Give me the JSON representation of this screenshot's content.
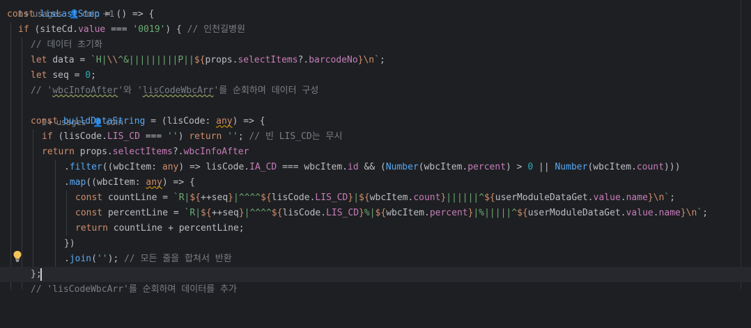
{
  "hints": {
    "top_usages": "1+ usages",
    "top_author": "coin +1",
    "build_usages": "1+ usages",
    "build_author": "coin"
  },
  "code": {
    "l1": {
      "a": "const ",
      "b": "lisLastStep",
      "c": " = () => {"
    },
    "l2": {
      "a": "if",
      "b": " (siteCd.",
      "c": "value",
      "d": " === ",
      "e": "'0019'",
      "f": ") { ",
      "g": "// 인천길병원"
    },
    "l3": {
      "a": "// 데이터 초기화"
    },
    "l4": {
      "a": "let ",
      "b": "data = ",
      "c": "`H|",
      "d": "\\\\",
      "e": "^&|||||||||P||",
      "f": "${",
      "g": "props.",
      "h": "selectItems",
      "i": "?.",
      "j": "barcodeNo",
      "k": "}",
      "l": "\\n",
      "m": "`",
      "n": ";"
    },
    "l5": {
      "a": "let ",
      "b": "seq = ",
      "c": "0",
      "d": ";"
    },
    "l6": {
      "a": "// '",
      "b": "wbcInfoAfter",
      "c": "'와 '",
      "d": "lisCodeWbcArr",
      "e": "'를 순회하며 데이터 구성"
    },
    "l8": {
      "a": "const ",
      "b": "buildDataString",
      "c": " = (lisCode: ",
      "d": "any",
      "e": ") => {"
    },
    "l9": {
      "a": "if",
      "b": " (lisCode.",
      "c": "LIS_CD",
      "d": " === ",
      "e": "''",
      "f": ") ",
      "g": "return ",
      "h": "''",
      "i": "; ",
      "j": "// 빈 LIS_CD는 무시"
    },
    "l10": {
      "a": "return ",
      "b": "props.",
      "c": "selectItems",
      "d": "?.",
      "e": "wbcInfoAfter"
    },
    "l11": {
      "a": ".",
      "b": "filter",
      "c": "((wbcItem: ",
      "d": "any",
      "e": ") => lisCode.",
      "f": "IA_CD",
      "g": " === wbcItem.",
      "h": "id",
      "i": " && (",
      "j": "Number",
      "k": "(wbcItem.",
      "l": "percent",
      "m": ") > ",
      "n": "0",
      "o": " || ",
      "p": "Number",
      "q": "(wbcItem.",
      "r": "count",
      "s": ")))"
    },
    "l12": {
      "a": ".",
      "b": "map",
      "c": "((wbcItem: ",
      "d": "any",
      "e": ") => {"
    },
    "l13": {
      "a": "const ",
      "b": "countLine = ",
      "c": "`R|",
      "d": "${",
      "e": "++seq",
      "f": "}",
      "g": "|^^^^",
      "h": "${",
      "i": "lisCode.",
      "j": "LIS_CD",
      "k": "}",
      "l": "|",
      "m": "${",
      "n": "wbcItem.",
      "o": "count",
      "p": "}",
      "q": "||||||^",
      "r": "${",
      "s": "userModuleDataGet.",
      "t": "value",
      "u": ".",
      "v": "name",
      "w": "}",
      "x": "\\n",
      "y": "`",
      "z": ";"
    },
    "l14": {
      "a": "const ",
      "b": "percentLine = ",
      "c": "`R|",
      "d": "${",
      "e": "++seq",
      "f": "}",
      "g": "|^^^^",
      "h": "${",
      "i": "lisCode.",
      "j": "LIS_CD",
      "k": "}",
      "l": "%|",
      "m": "${",
      "n": "wbcItem.",
      "o": "percent",
      "p": "}",
      "q": "|%|||||^",
      "r": "${",
      "s": "userModuleDataGet.",
      "t": "value",
      "u": ".",
      "v": "name",
      "w": "}",
      "x": "\\n",
      "y": "`",
      "z": ";"
    },
    "l15": {
      "a": "return ",
      "b": "countLine + percentLine;"
    },
    "l16": {
      "a": "})"
    },
    "l17": {
      "a": ".",
      "b": "join",
      "c": "(",
      "d": "''",
      "e": "); ",
      "f": "// 모든 줄을 합쳐서 반환"
    },
    "l18": {
      "a": "};"
    },
    "l19": {
      "a": "// 'lisCodeWbcArr'를 순회하며 데이터를 추가"
    }
  },
  "icons": {
    "lightbulb": "lightbulb-icon",
    "user": "user-icon"
  },
  "colors": {
    "background": "#1e1f22",
    "keyword": "#cf8e6d",
    "function": "#56a8f5",
    "property": "#c77dbb",
    "string": "#6aab73",
    "number": "#2aacb8",
    "comment": "#7a7e85"
  }
}
